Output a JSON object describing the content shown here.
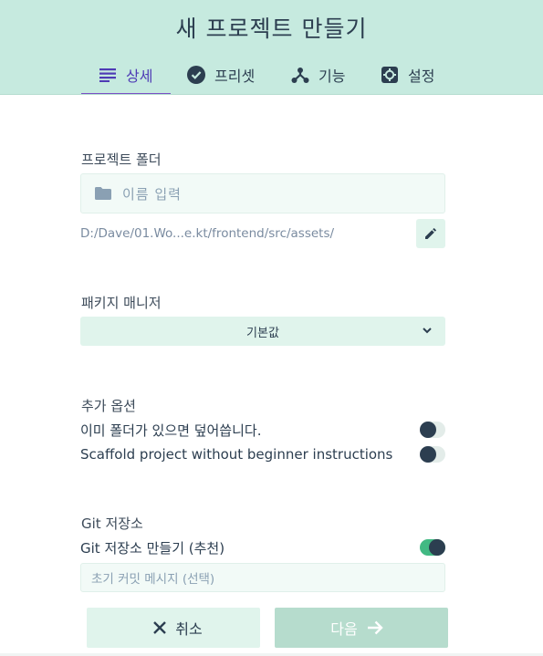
{
  "header": {
    "title": "새 프로젝트 만들기",
    "tabs": [
      {
        "label": "상세",
        "icon": "list-icon",
        "active": true
      },
      {
        "label": "프리셋",
        "icon": "check-circle-icon",
        "active": false
      },
      {
        "label": "기능",
        "icon": "branch-icon",
        "active": false
      },
      {
        "label": "설정",
        "icon": "gear-icon",
        "active": false
      }
    ]
  },
  "project_folder": {
    "label": "프로젝트 폴더",
    "placeholder": "이름 입력",
    "path": "D:/Dave/01.Wo...e.kt/frontend/src/assets/"
  },
  "package_manager": {
    "label": "패키지 매니저",
    "selected": "기본값"
  },
  "extra_options": {
    "label": "추가 옵션",
    "items": [
      {
        "label": "이미 폴더가 있으면 덮어씁니다.",
        "enabled": false
      },
      {
        "label": "Scaffold project without beginner instructions",
        "enabled": false
      }
    ]
  },
  "git": {
    "label": "Git 저장소",
    "create_label": "Git 저장소 만들기 (추천)",
    "create_enabled": true,
    "commit_placeholder": "초기 커밋 메시지 (선택)"
  },
  "footer": {
    "cancel_label": "취소",
    "next_label": "다음"
  },
  "colors": {
    "header_bg": "#c6eadf",
    "accent": "#42b983",
    "active_tab": "#4e3bb5",
    "text": "#2c3e50"
  }
}
